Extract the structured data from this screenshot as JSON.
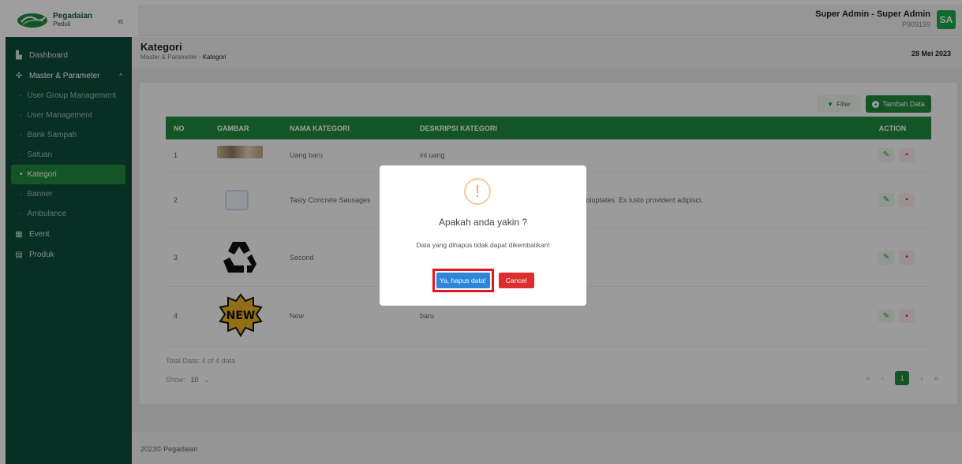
{
  "brand": {
    "name": "Pegadaian",
    "sub": "Peduli"
  },
  "topbar": {
    "collapse_icon": "«",
    "user_name": "Super Admin - Super Admin",
    "user_id": "P909199",
    "avatar": "SA"
  },
  "sidebar": {
    "dashboard": "Dashboard",
    "master": "Master & Parameter",
    "sub_items": [
      "User Group Management",
      "User Management",
      "Bank Sampah",
      "Satuan",
      "Kategori",
      "Banner",
      "Ambulance"
    ],
    "event": "Event",
    "produk": "Produk"
  },
  "page": {
    "title": "Kategori",
    "breadcrumb_parent": "Master & Parameter",
    "breadcrumb_sep": "-",
    "breadcrumb_current": "Kategori",
    "date": "28 Mei 2023"
  },
  "toolbar": {
    "filter": "Filter",
    "add": "Tambah Data"
  },
  "table": {
    "headers": [
      "NO",
      "GAMBAR",
      "NAMA KATEGORI",
      "DESKRIPSI KATEGORI",
      "ACTION"
    ],
    "rows": [
      {
        "no": "1",
        "name": "Uang baru",
        "desc": "ini uang"
      },
      {
        "no": "2",
        "name": "Tasty Concrete Sausages",
        "desc": "voluptates. Ex iusto provident adipisci."
      },
      {
        "no": "3",
        "name": "Second",
        "desc": ""
      },
      {
        "no": "4",
        "name": "New",
        "desc": "baru"
      }
    ]
  },
  "footer_info": {
    "total": "Total Data: 4 of 4 data",
    "show_label": "Show:",
    "show_value": "10",
    "page": "1"
  },
  "footer": {
    "text": "2023© Pegadaian"
  },
  "modal": {
    "title": "Apakah anda yakin ?",
    "text": "Data yang dihapus tidak dapat dikembalikan!",
    "confirm": "Ya, hapus data!",
    "cancel": "Cancel",
    "warn_icon": "!"
  },
  "colors": {
    "primary": "#1f8a3b",
    "sidebar": "#0e4d3a",
    "confirm": "#2c86d9",
    "cancel": "#dc2e2e",
    "highlight": "#e8131b"
  }
}
